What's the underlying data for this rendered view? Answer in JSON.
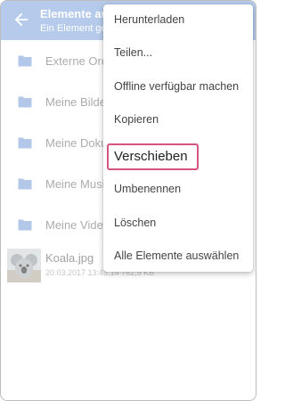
{
  "appbar": {
    "title": "Elemente au",
    "subtitle": "Ein Element gew"
  },
  "folders": [
    {
      "label": "Externe Ord"
    },
    {
      "label": "Meine Bilde"
    },
    {
      "label": "Meine Doku"
    },
    {
      "label": "Meine Musi"
    },
    {
      "label": "Meine Video"
    }
  ],
  "file": {
    "name": "Koala.jpg",
    "meta": "20.03.2017 13:45:14 762,5 KB"
  },
  "menu": {
    "items": [
      {
        "label": "Herunterladen"
      },
      {
        "label": "Teilen..."
      },
      {
        "label": "Offline verfügbar machen"
      },
      {
        "label": "Kopieren"
      },
      {
        "label": "Verschieben",
        "highlighted": true
      },
      {
        "label": "Umbenennen"
      },
      {
        "label": "Löschen"
      },
      {
        "label": "Alle Elemente auswählen"
      }
    ]
  },
  "colors": {
    "appbar": "#8fb0e0",
    "folder_icon": "#8aa9dc",
    "highlight_border": "#d4567f"
  },
  "icons": {
    "back": "arrow-left-icon",
    "folder": "folder-icon"
  }
}
